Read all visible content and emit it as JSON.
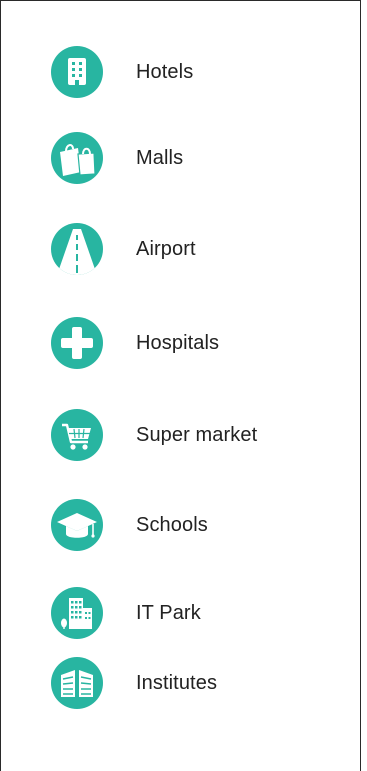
{
  "theme": {
    "accent": "#28b5a1",
    "text": "#222222",
    "border": "#2a2a2a"
  },
  "amenities": [
    {
      "label": "Hotels",
      "icon": "hotel-building-icon"
    },
    {
      "label": "Malls",
      "icon": "shopping-bags-icon"
    },
    {
      "label": "Airport",
      "icon": "runway-icon"
    },
    {
      "label": "Hospitals",
      "icon": "medical-cross-icon"
    },
    {
      "label": "Super market",
      "icon": "shopping-cart-icon"
    },
    {
      "label": "Schools",
      "icon": "graduation-cap-icon"
    },
    {
      "label": "IT Park",
      "icon": "office-buildings-icon"
    },
    {
      "label": "Institutes",
      "icon": "institute-building-icon"
    }
  ]
}
